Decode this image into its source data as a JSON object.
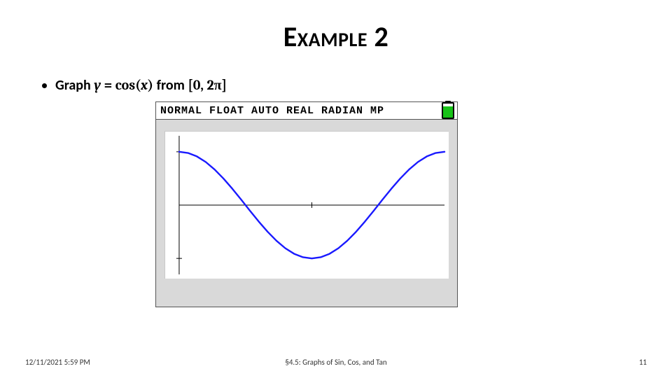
{
  "title": "Example 2",
  "prompt": {
    "lead": "Graph ",
    "varY": "y",
    "eq": " = ",
    "fn": "cos(",
    "varX": "x",
    "fnClose": ")",
    "from": " from ",
    "interval_open": "[",
    "interval_a": "0",
    "interval_sep": ", ",
    "interval_b": "2π",
    "interval_close": "]"
  },
  "calculator": {
    "status": "NORMAL FLOAT AUTO REAL RADIAN MP",
    "battery_icon": "battery-icon"
  },
  "chart_data": {
    "type": "line",
    "title": "",
    "xlabel": "",
    "ylabel": "",
    "xlim": [
      0,
      6.2832
    ],
    "ylim": [
      -1.3,
      1.3
    ],
    "x_ticks": [
      3.1416
    ],
    "y_ticks": [
      -1,
      1
    ],
    "series": [
      {
        "name": "cos(x)",
        "color": "#1a1aff",
        "x": [
          0,
          0.2094,
          0.4189,
          0.6283,
          0.8378,
          1.0472,
          1.2566,
          1.4661,
          1.6755,
          1.885,
          2.0944,
          2.3038,
          2.5133,
          2.7227,
          2.9322,
          3.1416,
          3.351,
          3.5605,
          3.7699,
          3.9794,
          4.1888,
          4.3982,
          4.6077,
          4.8171,
          5.0265,
          5.236,
          5.4454,
          5.6549,
          5.8643,
          6.0737,
          6.2832
        ],
        "values": [
          1,
          0.9781,
          0.9135,
          0.809,
          0.6691,
          0.5,
          0.309,
          0.1045,
          -0.1045,
          -0.309,
          -0.5,
          -0.6691,
          -0.809,
          -0.9135,
          -0.9781,
          -1,
          -0.9781,
          -0.9135,
          -0.809,
          -0.6691,
          -0.5,
          -0.309,
          -0.1045,
          0.1045,
          0.309,
          0.5,
          0.6691,
          0.809,
          0.9135,
          0.9781,
          1
        ]
      }
    ]
  },
  "footer": {
    "date": "12/11/2021 5:59 PM",
    "section": "§4.5: Graphs of Sin, Cos, and Tan",
    "page": "11"
  }
}
